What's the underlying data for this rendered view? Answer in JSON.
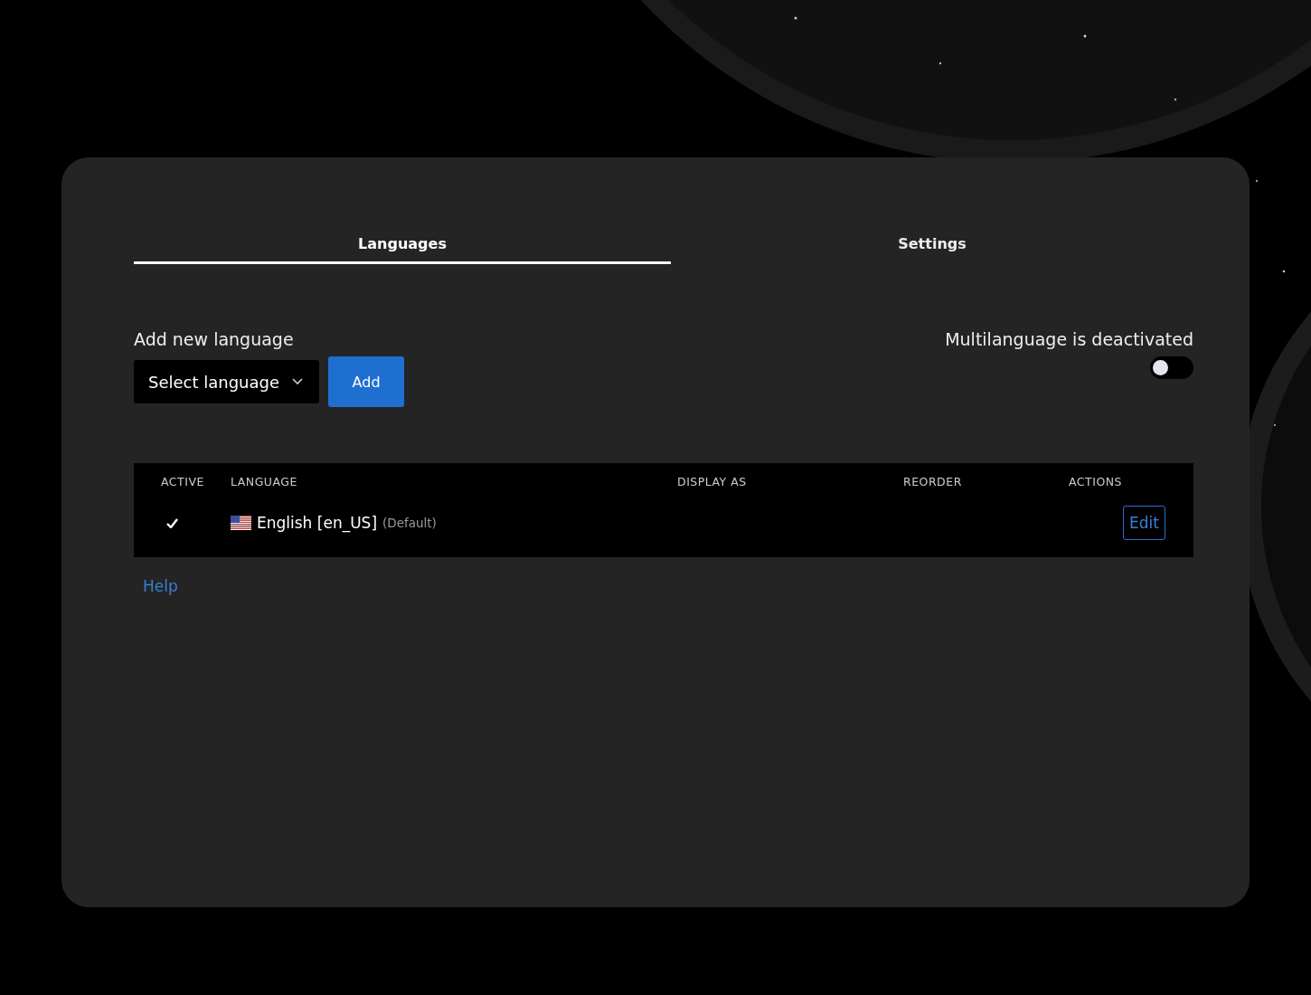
{
  "tabs": [
    {
      "label": "Languages",
      "selected": true
    },
    {
      "label": "Settings",
      "selected": false
    }
  ],
  "add_language": {
    "label": "Add new language",
    "select": {
      "placeholder": "Select language"
    },
    "button": "Add"
  },
  "multilanguage": {
    "label": "Multilanguage is deactivated",
    "on": false
  },
  "table": {
    "columns": [
      "ACTIVE",
      "LANGUAGE",
      "DISPLAY AS",
      "REORDER",
      "ACTIONS"
    ],
    "rows": [
      {
        "active": true,
        "language": "English [en_US]",
        "note": "(Default)",
        "action": "Edit"
      }
    ]
  },
  "help_link": "Help"
}
